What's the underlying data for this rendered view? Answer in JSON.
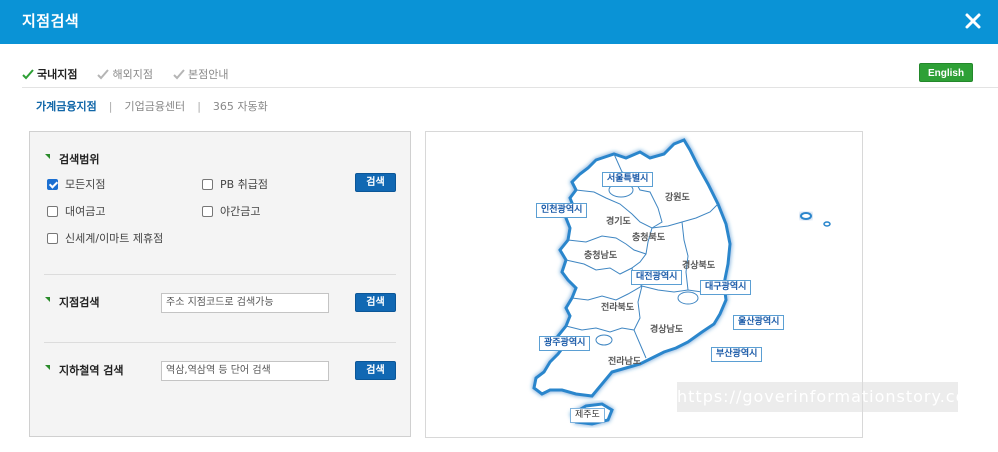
{
  "window": {
    "title": "지점검색"
  },
  "top_tabs": [
    {
      "label": "국내지점",
      "active": true
    },
    {
      "label": "해외지점",
      "active": false
    },
    {
      "label": "본점안내",
      "active": false
    }
  ],
  "english_button": "English",
  "sub_tabs": [
    {
      "label": "가계금융지점",
      "active": true
    },
    {
      "label": "기업금융센터",
      "active": false
    },
    {
      "label": "365 자동화",
      "active": false
    }
  ],
  "search_range": {
    "title": "검색범위",
    "options": [
      {
        "label": "모든지점",
        "checked": true
      },
      {
        "label": "PB 취급점",
        "checked": false
      },
      {
        "label": "대여금고",
        "checked": false
      },
      {
        "label": "야간금고",
        "checked": false
      },
      {
        "label": "신세계/이마트 제휴점",
        "checked": false
      }
    ],
    "button": "검색"
  },
  "branch_search": {
    "title": "지점검색",
    "placeholder": "주소 지점코드로 검색가능",
    "button": "검색"
  },
  "subway_search": {
    "title": "지하철역 검색",
    "placeholder": "역삼,역삼역 등 단어 검색",
    "button": "검색"
  },
  "map": {
    "cities": [
      "서울특별시",
      "인천광역시",
      "대전광역시",
      "대구광역시",
      "울산광역시",
      "광주광역시",
      "부산광역시",
      "제주도"
    ],
    "provinces": [
      "강원도",
      "경기도",
      "충청북도",
      "충청남도",
      "경상북도",
      "전라북도",
      "경상남도",
      "전라남도"
    ]
  },
  "watermark": "https://goverinformationstory.com",
  "colors": {
    "header": "#0a93d6",
    "button": "#1168b3",
    "english": "#2ea036",
    "map_border": "#1f7fc4"
  }
}
